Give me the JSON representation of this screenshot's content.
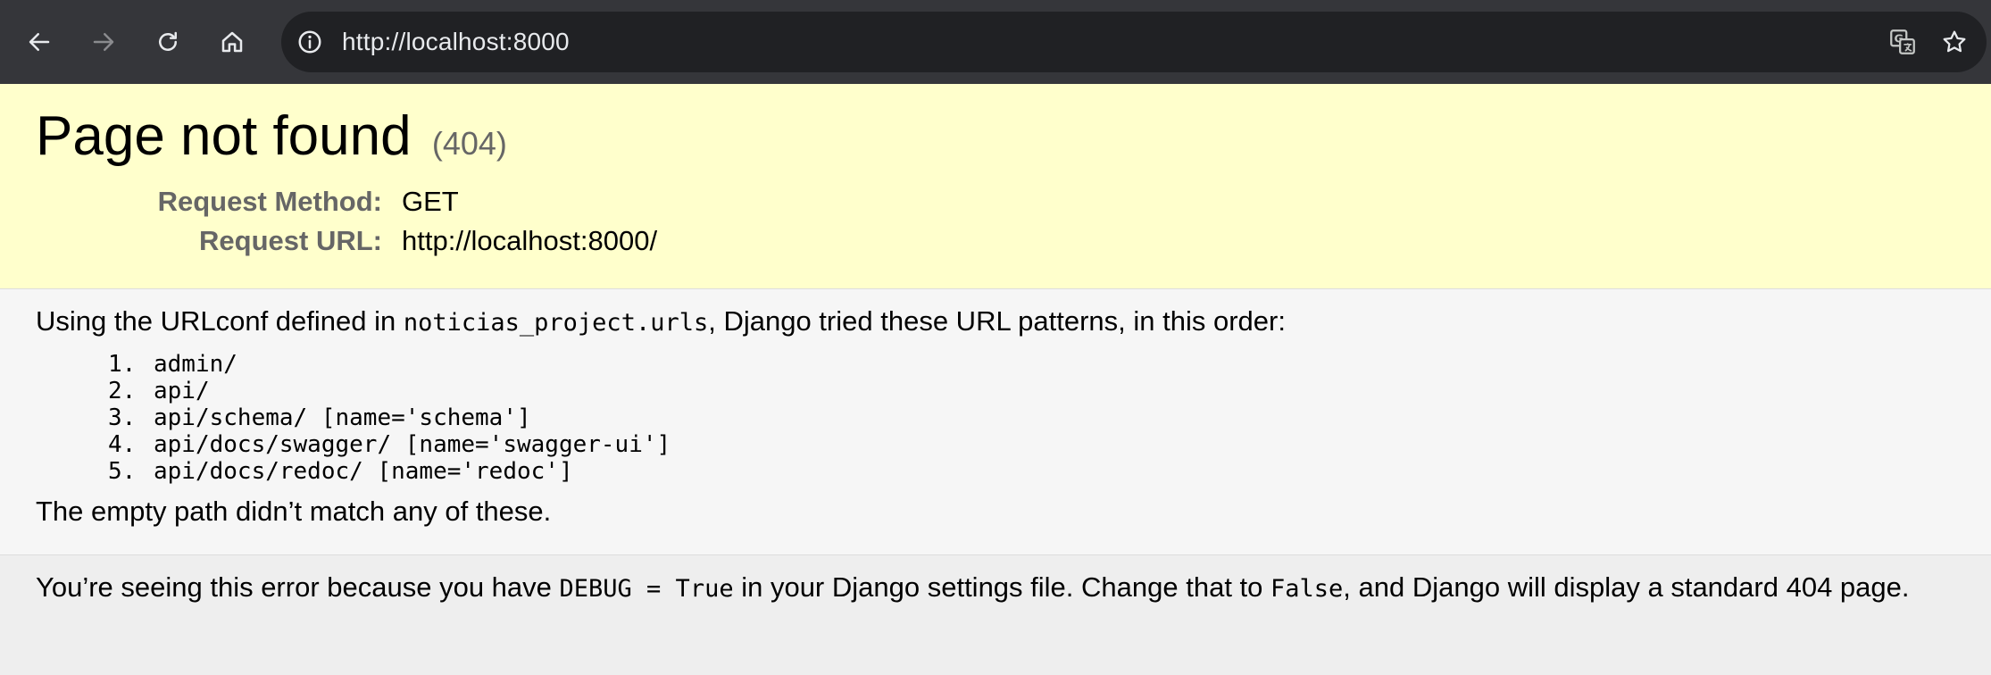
{
  "browser": {
    "url": "http://localhost:8000",
    "icons": {
      "back": "back-arrow-icon",
      "forward": "forward-arrow-icon",
      "reload": "reload-icon",
      "home": "home-icon",
      "site_info": "site-info-icon",
      "translate": "translate-icon",
      "bookmark": "bookmark-star-icon"
    }
  },
  "summary": {
    "title": "Page not found",
    "status_code": "(404)",
    "request_method_label": "Request Method:",
    "request_method_value": "GET",
    "request_url_label": "Request URL:",
    "request_url_value": "http://localhost:8000/"
  },
  "info": {
    "intro_before": "Using the URLconf defined in ",
    "urlconf": "noticias_project.urls",
    "intro_after": ", Django tried these URL patterns, in this order:",
    "patterns": [
      "admin/",
      "api/",
      "api/schema/ [name='schema']",
      "api/docs/swagger/ [name='swagger-ui']",
      "api/docs/redoc/ [name='redoc']"
    ],
    "no_match": "The empty path didn’t match any of these."
  },
  "explanation": {
    "part1": "You’re seeing this error because you have ",
    "debug_code": "DEBUG = True",
    "part2": " in your Django settings file. Change that to ",
    "false_code": "False",
    "part3": ", and Django will display a standard 404 page."
  },
  "colors": {
    "chrome_bg": "#35363a",
    "omnibox_bg": "#202124",
    "summary_bg": "#ffffcc",
    "info_bg": "#f6f6f6",
    "explanation_bg": "#eeeeee"
  }
}
